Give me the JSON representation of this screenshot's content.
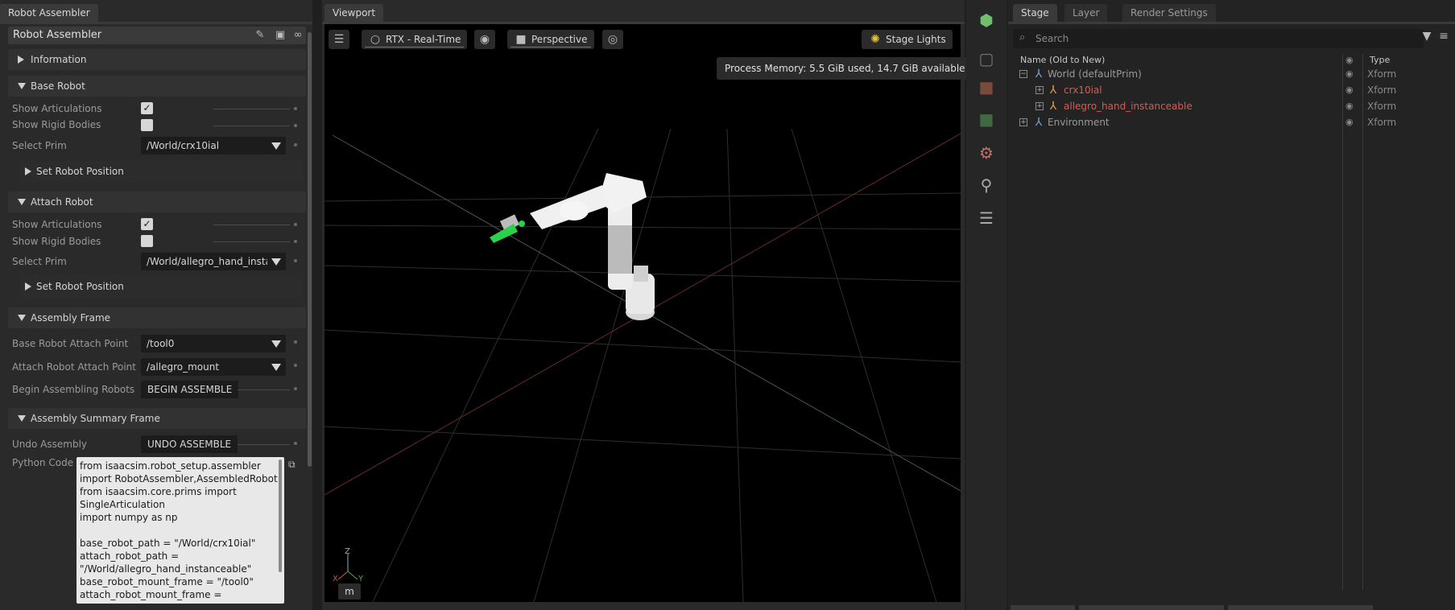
{
  "left_panel": {
    "tab_title": "Robot Assembler",
    "header_title": "Robot Assembler",
    "sections": {
      "information": "Information",
      "base_robot": "Base Robot",
      "attach_robot": "Attach Robot",
      "assembly_frame": "Assembly Frame",
      "assembly_summary": "Assembly Summary Frame"
    },
    "base_robot": {
      "show_articulations_label": "Show Articulations",
      "show_articulations_checked": true,
      "show_rigid_bodies_label": "Show Rigid Bodies",
      "show_rigid_bodies_checked": false,
      "select_prim_label": "Select Prim",
      "select_prim_value": "/World/crx10ial",
      "set_position_label": "Set Robot Position"
    },
    "attach_robot": {
      "show_articulations_label": "Show Articulations",
      "show_articulations_checked": true,
      "show_rigid_bodies_label": "Show Rigid Bodies",
      "show_rigid_bodies_checked": false,
      "select_prim_label": "Select Prim",
      "select_prim_value": "/World/allegro_hand_insta",
      "set_position_label": "Set Robot Position"
    },
    "assembly_frame": {
      "base_attach_label": "Base Robot Attach Point",
      "base_attach_value": "/tool0",
      "attach_attach_label": "Attach Robot Attach Point",
      "attach_attach_value": "/allegro_mount",
      "begin_label": "Begin Assembling Robots",
      "begin_button": "BEGIN ASSEMBLE"
    },
    "summary": {
      "undo_label": "Undo Assembly",
      "undo_button": "UNDO ASSEMBLE",
      "python_label": "Python Code",
      "python_code": "from isaacsim.robot_setup.assembler\nimport RobotAssembler,AssembledRobot\nfrom isaacsim.core.prims import\nSingleArticulation\nimport numpy as np\n\nbase_robot_path = \"/World/crx10ial\"\nattach_robot_path =\n\"/World/allegro_hand_instanceable\"\nbase_robot_mount_frame = \"/tool0\"\nattach_robot_mount_frame ="
    }
  },
  "viewport": {
    "tab_title": "Viewport",
    "render_mode": "RTX - Real-Time",
    "camera": "Perspective",
    "lights": "Stage Lights",
    "memory": "Process Memory: 5.5 GiB used, 14.7 GiB available",
    "units": "m",
    "axis_labels": {
      "x": "X",
      "y": "Y",
      "z": "Z"
    }
  },
  "stage": {
    "tabs": [
      "Stage",
      "Layer",
      "Render Settings"
    ],
    "search_placeholder": "Search",
    "col_name": "Name (Old to New)",
    "col_type": "Type",
    "rows": [
      {
        "name": "World (defaultPrim)",
        "type": "Xform",
        "color": "#9a9a9a"
      },
      {
        "name": "crx10ial",
        "type": "Xform",
        "color": "#e0574f"
      },
      {
        "name": "allegro_hand_instanceable",
        "type": "Xform",
        "color": "#e0574f"
      },
      {
        "name": "Environment",
        "type": "Xform",
        "color": "#9a9a9a"
      }
    ]
  },
  "toolbar_icons": [
    "select-mode-icon",
    "clear-icon",
    "cube-icon",
    "green-cube-icon",
    "gear-icon",
    "weight-icon",
    "sliders-icon"
  ]
}
